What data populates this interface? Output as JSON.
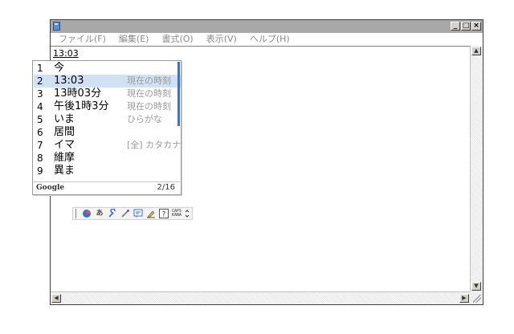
{
  "menubar": {
    "items": [
      "ファイル(F)",
      "編集(E)",
      "書式(O)",
      "表示(V)",
      "ヘルプ(H)"
    ]
  },
  "editor": {
    "text": "13:03"
  },
  "candidates": {
    "items": [
      {
        "num": "1",
        "word": "今",
        "note": ""
      },
      {
        "num": "2",
        "word": "13:03",
        "note": "現在の時刻"
      },
      {
        "num": "3",
        "word": "13時03分",
        "note": "現在の時刻"
      },
      {
        "num": "4",
        "word": "午後1時3分",
        "note": "現在の時刻"
      },
      {
        "num": "5",
        "word": "いま",
        "note": "ひらがな"
      },
      {
        "num": "6",
        "word": "居間",
        "note": ""
      },
      {
        "num": "7",
        "word": "イマ",
        "note": "[全] カタカナ"
      },
      {
        "num": "8",
        "word": "維摩",
        "note": ""
      },
      {
        "num": "9",
        "word": "異ま",
        "note": ""
      }
    ],
    "selected_index": 1,
    "brand": "Google",
    "page": "2/16"
  },
  "langbar": {
    "mode_glyph": "あ",
    "caps_label": "CAPS",
    "kana_label": "KANA"
  },
  "window_buttons": {
    "minimize": "_",
    "maximize": "□",
    "close": "×"
  },
  "scroll_arrows": {
    "up": "▲",
    "down": "▼",
    "left": "◀",
    "right": "▶"
  },
  "colors": {
    "titlebar": "#a8a8a8",
    "selection": "#cfe2f5",
    "accent": "#3c6fd0"
  }
}
